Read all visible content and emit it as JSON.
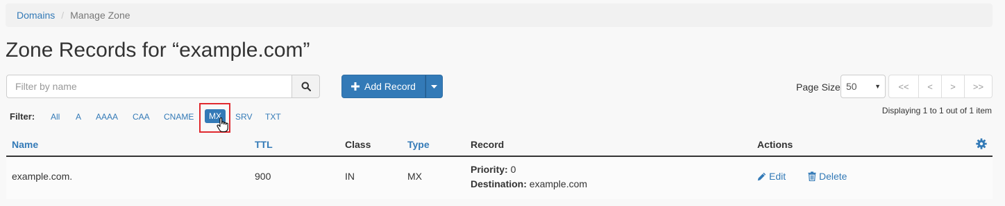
{
  "breadcrumb": {
    "link": "Domains",
    "separator": "/",
    "current": "Manage Zone"
  },
  "title": "Zone Records for “example.com”",
  "search": {
    "placeholder": "Filter by name",
    "value": ""
  },
  "add_record": {
    "label": "Add Record"
  },
  "page_size": {
    "label": "Page Size",
    "value": "50"
  },
  "pager": {
    "first": "<<",
    "prev": "<",
    "next": ">",
    "last": ">>"
  },
  "displaying": "Displaying 1 to 1 out of 1 item",
  "filter": {
    "label": "Filter:",
    "options": [
      "All",
      "A",
      "AAAA",
      "CAA",
      "CNAME",
      "MX",
      "SRV",
      "TXT"
    ],
    "active": "MX"
  },
  "table": {
    "columns": {
      "name": "Name",
      "ttl": "TTL",
      "class": "Class",
      "type": "Type",
      "record": "Record",
      "actions": "Actions"
    },
    "rows": [
      {
        "name": "example.com.",
        "ttl": "900",
        "class": "IN",
        "type": "MX",
        "priority_label": "Priority:",
        "priority": "0",
        "destination_label": "Destination:",
        "destination": "example.com",
        "edit": "Edit",
        "delete": "Delete"
      }
    ]
  },
  "colors": {
    "primary": "#337ab7",
    "highlight": "#e0282e",
    "text": "#333333"
  }
}
